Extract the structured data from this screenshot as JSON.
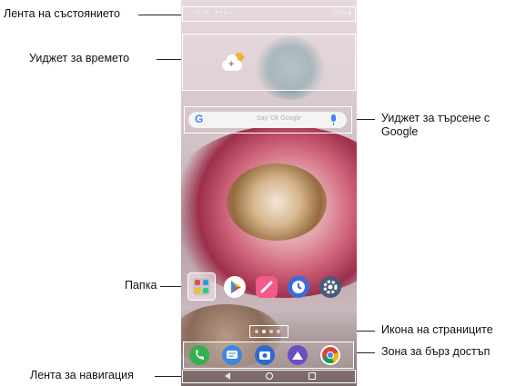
{
  "callouts": {
    "status_bar": "Лента на състоянието",
    "weather_widget": "Уиджет за времето",
    "google_search_line1": "Уиджет за търсене с",
    "google_search_line2": "Google",
    "folder": "Папка",
    "page_icon": "Икона на страниците",
    "quick_access": "Зона за бърз достъп",
    "navigation_bar": "Лента за навигация"
  },
  "status_bar": {
    "time": "12:30",
    "battery": "100%"
  },
  "search_widget": {
    "logo": "G",
    "placeholder": "Say 'Ok Google'"
  },
  "weather_widget": {
    "plus": "+"
  },
  "home_apps": [
    {
      "name": "folder-icon",
      "color": "#c9c2c6"
    },
    {
      "name": "play-store-icon",
      "color": "#ffffff"
    },
    {
      "name": "notes-icon",
      "color": "#f25a8a"
    },
    {
      "name": "clock-icon",
      "color": "#3b6bd6"
    },
    {
      "name": "settings-icon",
      "color": "#4a5a78"
    }
  ],
  "dock_apps": [
    {
      "name": "phone-icon",
      "color": "#35b04e"
    },
    {
      "name": "messages-icon",
      "color": "#3d87e0"
    },
    {
      "name": "camera-icon",
      "color": "#2a6bd1"
    },
    {
      "name": "gallery-icon",
      "color": "#6a4fc4"
    },
    {
      "name": "chrome-icon",
      "color": "#ffffff"
    }
  ]
}
